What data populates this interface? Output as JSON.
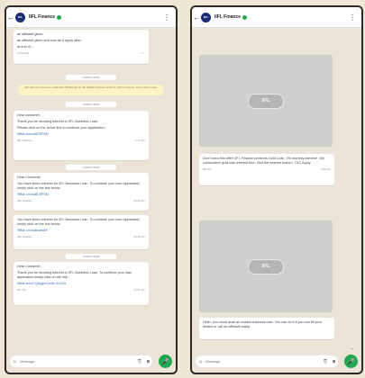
{
  "left": {
    "header": {
      "back": "←",
      "avatar": "IIFL",
      "name": "IIFL Finance",
      "menu": "⋮"
    },
    "bubble1": {
      "line1": "an affidavit given",
      "line2": "an affidavit given and how do it apply after",
      "line3": "at end of ...",
      "time": "12:51 PM",
      "check": "✓✓"
    },
    "date1": "2 March 2024",
    "notice": "IIFL Finance has been verified by WhatsApp as the official business account of IIFL Finance. Tap to learn more.",
    "date2": "3 March 2024",
    "bubble2": {
      "p1": "Dear customer,",
      "p2": "Thank you for showing interest in IIFL Business Loan.",
      "p3": "Please click on the below link to continue your application -",
      "link": "iiflbiz.com/a8C5FSM",
      "meta": "IIFL Finance",
      "time": "1:17 pm"
    },
    "date3": "4 March 2024",
    "bubble3": {
      "p1": "Dear Customer,",
      "p2": "You have been referred for IIFL Business Loan. To continue your loan application kindly click on the link below -",
      "link": "iiflbiz.com/a8C5FSM",
      "meta": "IIFL Finance",
      "time": "12:53 pm"
    },
    "bubble4": {
      "p1": "You have been referred for IIFL Business Loan. To continue your loan application kindly click on the link below -",
      "link": "iiflbiz.com/a8vwtwM",
      "meta": "IIFL Finance",
      "time": "12:56 pm"
    },
    "date4": "5 March 2024",
    "bubble5": {
      "p1": "Dear Customer,",
      "p2": "Thank you for showing interest in IIFL Business Loan. To continue your loan application kindly click on the link -",
      "link": "iiflbiz.com/?QAygmCode=11203",
      "meta": "IIFL Fin",
      "time": "12:51 pm"
    },
    "input": {
      "placeholder": "Message",
      "emoji": "☺",
      "attach": "⎘",
      "camera": "◙",
      "mic": "🎤"
    }
  },
  "right": {
    "header": {
      "back": "←",
      "avatar": "IIFL",
      "name": "IIFL Finance",
      "menu": "⋮"
    },
    "image1": {
      "logo": "IIFL"
    },
    "bubble1": {
      "p1": "Don't miss this offer! IIFL Finance presents Gold Loan. 0% monthly interest*. 6th consecutive gold loan interest free. Visit the nearest branch. T&C Apply.",
      "meta": "IIFL Fin",
      "time": "1:48 pm"
    },
    "image2": {
      "logo": "IIFL"
    },
    "bubble2": {
      "p1": "Hello, you could avail an instant business loan. You can do it if you can fill your details or call an affidavit easily"
    },
    "scroll": "⌄",
    "input": {
      "placeholder": "Message",
      "emoji": "☺",
      "attach": "⎘",
      "camera": "◙",
      "mic": "🎤"
    }
  }
}
